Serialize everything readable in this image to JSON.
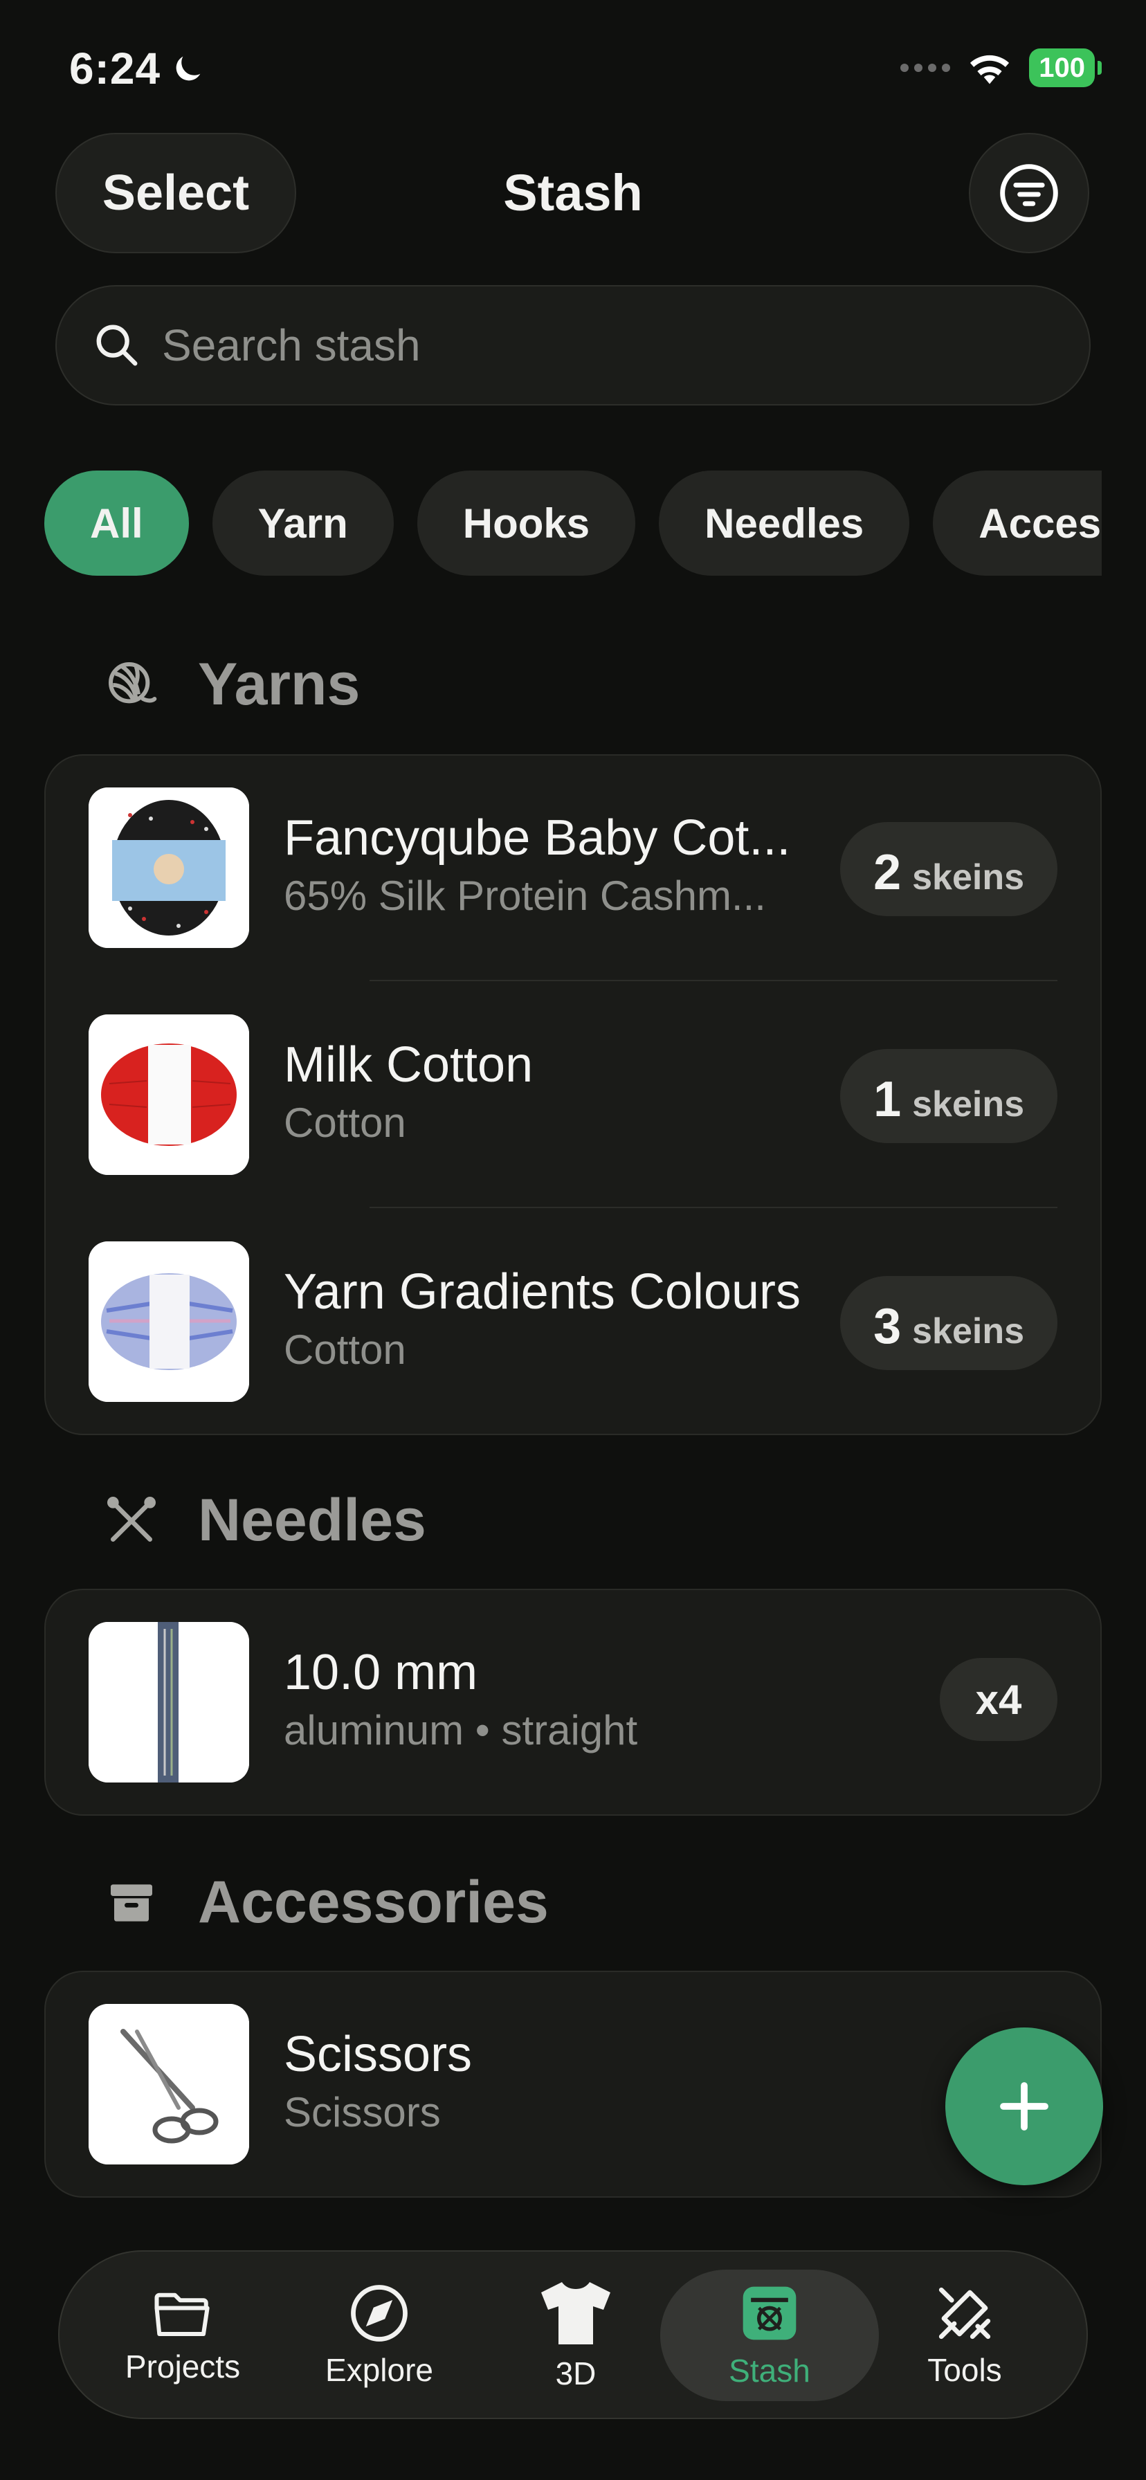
{
  "status_bar": {
    "time": "6:24",
    "battery": "100"
  },
  "header": {
    "select_label": "Select",
    "title": "Stash"
  },
  "search": {
    "placeholder": "Search stash"
  },
  "filters": [
    "All",
    "Yarn",
    "Hooks",
    "Needles",
    "Access"
  ],
  "sections": {
    "yarns": {
      "title": "Yarns",
      "items": [
        {
          "name": "Fancyqube Baby Cot...",
          "subtitle": "65% Silk Protein Cashm...",
          "count": "2",
          "unit": "skeins"
        },
        {
          "name": "Milk Cotton",
          "subtitle": "Cotton",
          "count": "1",
          "unit": "skeins"
        },
        {
          "name": "Yarn Gradients Colours",
          "subtitle": "Cotton",
          "count": "3",
          "unit": "skeins"
        }
      ]
    },
    "needles": {
      "title": "Needles",
      "items": [
        {
          "name": "10.0 mm",
          "subtitle": "aluminum • straight",
          "count": "x4"
        }
      ]
    },
    "accessories": {
      "title": "Accessories",
      "items": [
        {
          "name": "Scissors",
          "subtitle": "Scissors"
        }
      ]
    }
  },
  "tab_bar": {
    "tabs": [
      {
        "label": "Projects",
        "icon": "folder-icon"
      },
      {
        "label": "Explore",
        "icon": "compass-icon"
      },
      {
        "label": "3D",
        "icon": "tshirt-icon"
      },
      {
        "label": "Stash",
        "icon": "stash-basket-icon",
        "active": true
      },
      {
        "label": "Tools",
        "icon": "tools-icon"
      }
    ]
  },
  "colors": {
    "accent": "#3b9c6c",
    "background": "#0f100e",
    "card": "#1a1b18"
  }
}
